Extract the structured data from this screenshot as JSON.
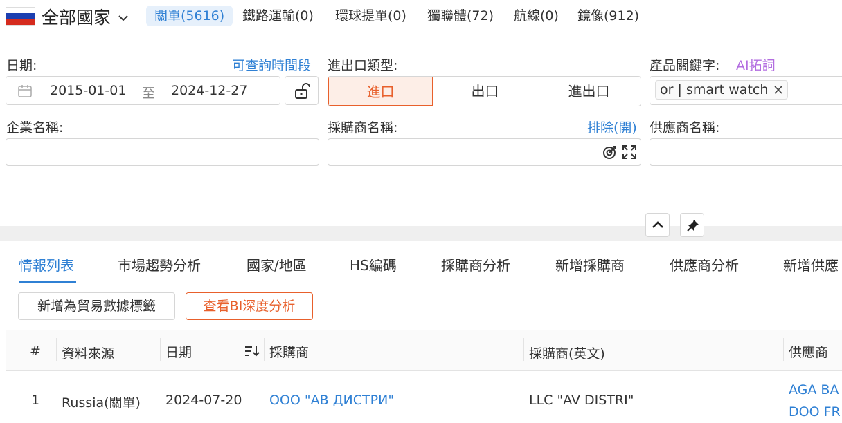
{
  "header": {
    "country": "全部國家",
    "tabs": [
      {
        "label": "關單(5616)"
      },
      {
        "label": "鐵路運輸(0)"
      },
      {
        "label": "環球提單(0)"
      },
      {
        "label": "獨聯體(72)"
      },
      {
        "label": "航線(0)"
      },
      {
        "label": "鏡像(912)"
      }
    ]
  },
  "filters": {
    "date_label": "日期:",
    "date_link": "可查詢時間段",
    "date_from": "2015-01-01",
    "date_to_word": "至",
    "date_to": "2024-12-27",
    "io_label": "進出口類型:",
    "io_options": [
      "進口",
      "出口",
      "進出口"
    ],
    "keyword_label": "產品關鍵字:",
    "keyword_ai": "AI拓詞",
    "keyword_chip": "or | smart watch",
    "company_label": "企業名稱:",
    "buyer_label": "採購商名稱:",
    "buyer_exclude": "排除(開)",
    "supplier_label": "供應商名稱:"
  },
  "subtabs": [
    "情報列表",
    "市場趨勢分析",
    "國家/地區",
    "HS編碼",
    "採購商分析",
    "新增採購商",
    "供應商分析",
    "新增供應"
  ],
  "actions": {
    "tag_button": "新增為貿易數據標籤",
    "bi_button": "查看BI深度分析"
  },
  "table": {
    "headers": [
      "#",
      "資料來源",
      "日期",
      "採購商",
      "採購商(英文)",
      "供應商"
    ],
    "rows": [
      {
        "index": "1",
        "source": "Russia(關單)",
        "date": "2024-07-20",
        "buyer": "ООО \"АВ ДИСТРИ\"",
        "buyer_en": "LLC \"AV DISTRI\"",
        "supplier_line1": "AGA BA",
        "supplier_line2": "DOO FR"
      }
    ]
  },
  "colors": {
    "accent": "#2f80d4",
    "orange": "#e8602c",
    "ai": "#b36ee0"
  }
}
